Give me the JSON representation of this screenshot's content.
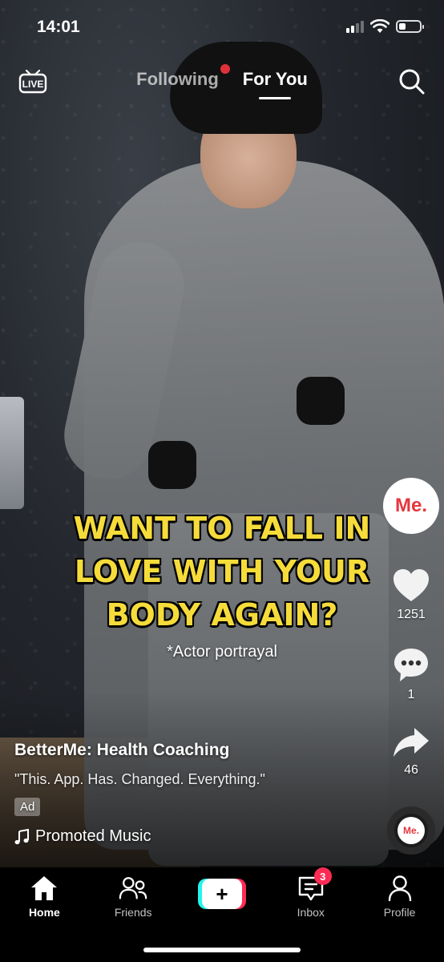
{
  "status_bar": {
    "time": "14:01",
    "battery_level": 0.35
  },
  "top_nav": {
    "live_label": "LIVE",
    "tabs": [
      {
        "label": "Following",
        "active": false
      },
      {
        "label": "For You",
        "active": true
      }
    ]
  },
  "video": {
    "caption_lines": [
      "WANT TO FALL IN",
      "LOVE WITH YOUR",
      "BODY AGAIN?"
    ],
    "disclaimer": "*Actor portrayal"
  },
  "side_actions": {
    "avatar_text": "Me.",
    "likes": "1251",
    "comments": "1",
    "shares": "46",
    "music_disc_text": "Me."
  },
  "post_info": {
    "account": "BetterMe: Health Coaching",
    "description": "\"This. App. Has. Changed. Everything.\"",
    "ad_label": "Ad",
    "music": "Promoted Music"
  },
  "tab_bar": {
    "home": "Home",
    "friends": "Friends",
    "create": "+",
    "inbox": "Inbox",
    "inbox_badge": "3",
    "profile": "Profile"
  },
  "colors": {
    "caption_yellow": "#f6dc3a",
    "brand_red": "#e4373f",
    "tiktok_cyan": "#25f4ee",
    "tiktok_pink": "#fe2c55"
  }
}
